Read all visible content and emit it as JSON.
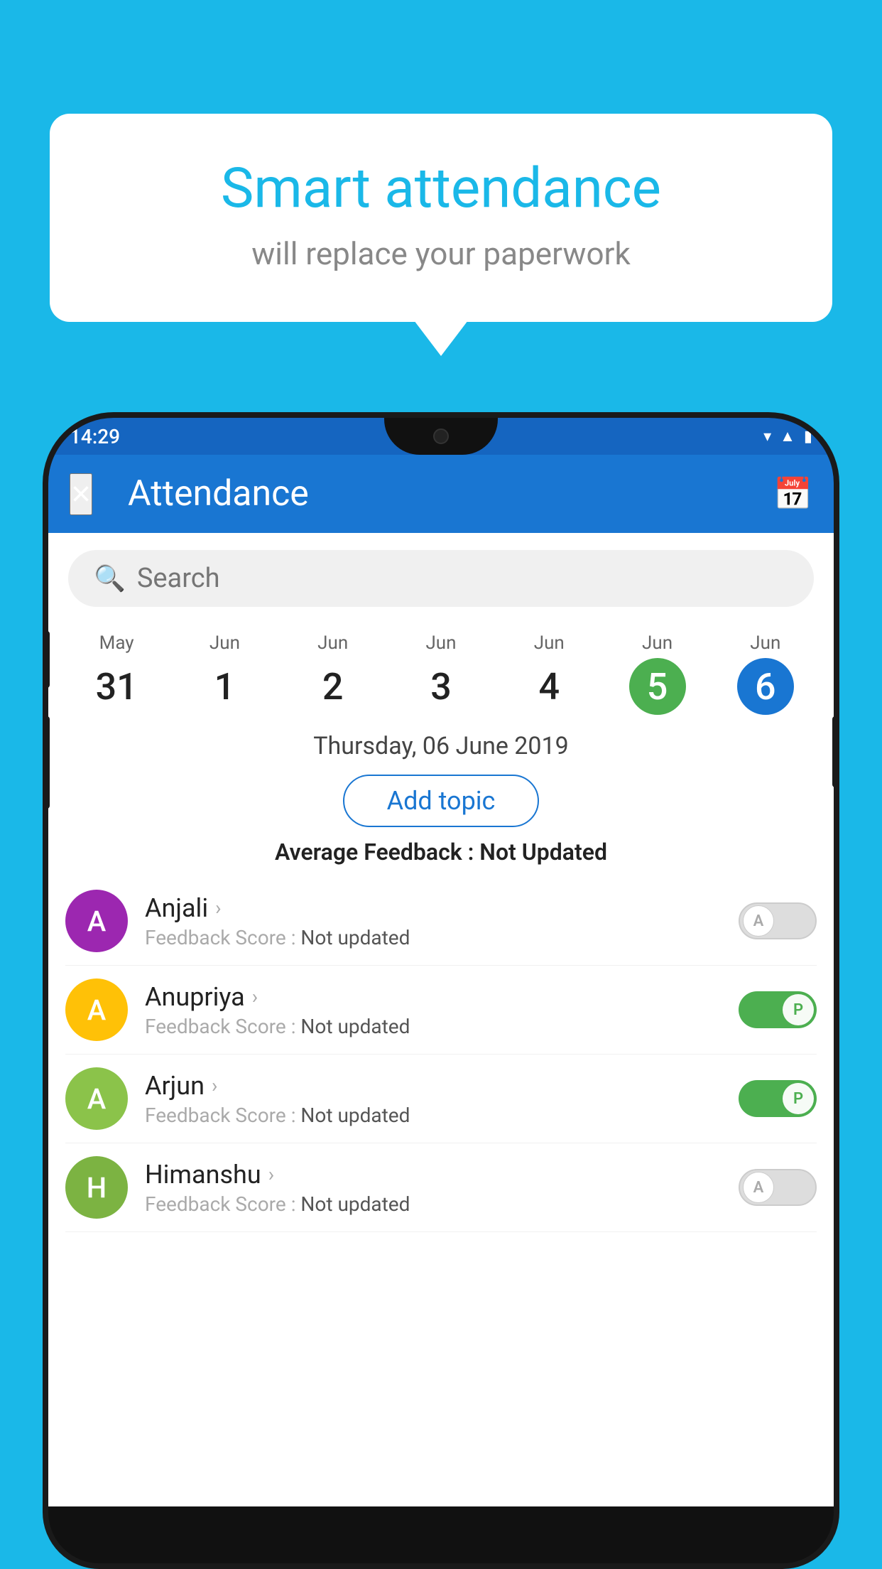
{
  "background_color": "#1ab8e8",
  "speech_bubble": {
    "title": "Smart attendance",
    "subtitle": "will replace your paperwork"
  },
  "status_bar": {
    "time": "14:29",
    "icons": [
      "wifi",
      "signal",
      "battery"
    ]
  },
  "app_bar": {
    "title": "Attendance",
    "close_label": "×"
  },
  "search": {
    "placeholder": "Search"
  },
  "date_strip": [
    {
      "month": "May",
      "day": "31",
      "state": "normal"
    },
    {
      "month": "Jun",
      "day": "1",
      "state": "normal"
    },
    {
      "month": "Jun",
      "day": "2",
      "state": "normal"
    },
    {
      "month": "Jun",
      "day": "3",
      "state": "normal"
    },
    {
      "month": "Jun",
      "day": "4",
      "state": "normal"
    },
    {
      "month": "Jun",
      "day": "5",
      "state": "today"
    },
    {
      "month": "Jun",
      "day": "6",
      "state": "selected"
    }
  ],
  "selected_date": "Thursday, 06 June 2019",
  "add_topic_label": "Add topic",
  "avg_feedback_label": "Average Feedback :",
  "avg_feedback_value": "Not Updated",
  "students": [
    {
      "name": "Anjali",
      "avatar_letter": "A",
      "avatar_color": "#9c27b0",
      "feedback_label": "Feedback Score :",
      "feedback_value": "Not updated",
      "toggle": "off",
      "toggle_letter": "A"
    },
    {
      "name": "Anupriya",
      "avatar_letter": "A",
      "avatar_color": "#ffc107",
      "feedback_label": "Feedback Score :",
      "feedback_value": "Not updated",
      "toggle": "on",
      "toggle_letter": "P"
    },
    {
      "name": "Arjun",
      "avatar_letter": "A",
      "avatar_color": "#8bc34a",
      "feedback_label": "Feedback Score :",
      "feedback_value": "Not updated",
      "toggle": "on",
      "toggle_letter": "P"
    },
    {
      "name": "Himanshu",
      "avatar_letter": "H",
      "avatar_color": "#8bc34a",
      "feedback_label": "Feedback Score :",
      "feedback_value": "Not updated",
      "toggle": "off",
      "toggle_letter": "A"
    }
  ]
}
